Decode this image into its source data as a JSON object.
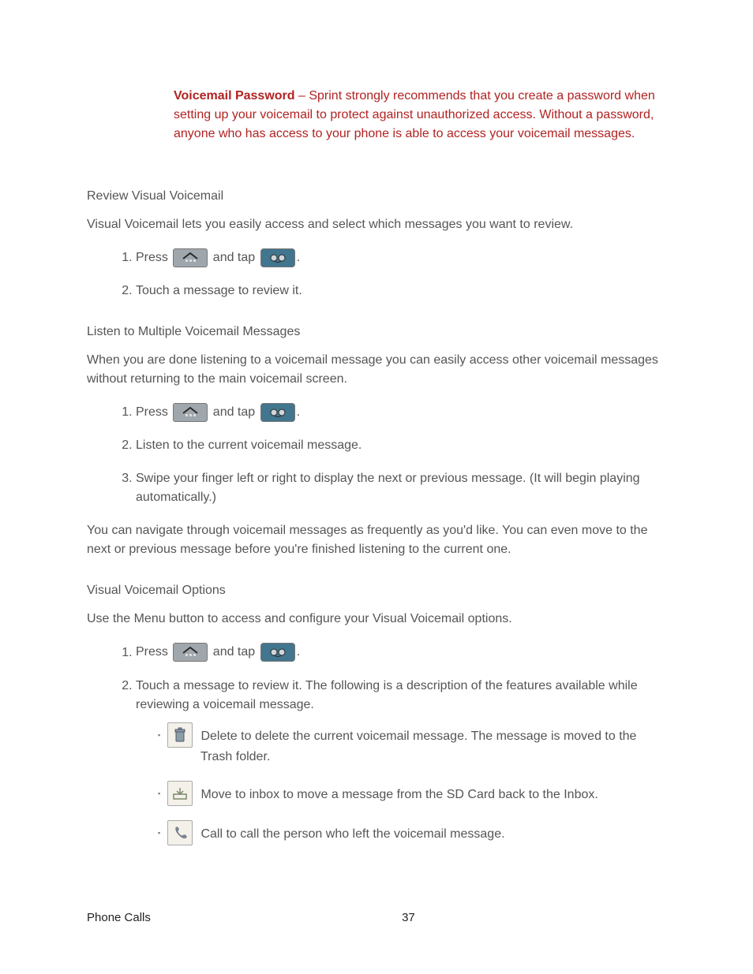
{
  "note": {
    "lead": "Voicemail Password",
    "body": " – Sprint strongly recommends that you create a password when setting up your voicemail to protect against unauthorized access. Without a password, anyone who has access to your phone is able to access your voicemail messages."
  },
  "sections": {
    "review": {
      "heading": "Review Visual Voicemail",
      "intro": "Visual Voicemail lets you easily access and select which messages you want to review.",
      "step1a": "Press ",
      "step1b": " and tap ",
      "step1c": ".",
      "step2": "Touch a message to review it."
    },
    "listen": {
      "heading": "Listen to Multiple Voicemail Messages",
      "intro": "When you are done listening to a voicemail message you can easily access other voicemail messages without returning to the main voicemail screen.",
      "step1a": "Press ",
      "step1b": " and tap ",
      "step1c": ".",
      "step2": "Listen to the current voicemail message.",
      "step3": "Swipe your finger left or right to display the next or previous message. (It will begin playing automatically.)",
      "outro": "You can navigate through voicemail messages as frequently as you'd like. You can even move to the next or previous message before you're finished listening to the current one."
    },
    "options": {
      "heading": "Visual Voicemail Options",
      "intro": "Use the Menu button to access and configure your Visual Voicemail options.",
      "step1a": "Press ",
      "step1b": " and tap ",
      "step1c": ".",
      "step2": "Touch a message to review it. The following is a description of the features available while reviewing a voicemail message.",
      "bullet1_label": "Delete",
      "bullet1_a": " to delete the current voicemail message. The message is moved to the ",
      "bullet1_b": "Trash",
      "bullet1_c": " folder.",
      "bullet2_label": "Move to inbox",
      "bullet2_a": " to move a message from the SD Card back to the Inbox.",
      "bullet3_label": "Call",
      "bullet3_a": " to call the person who left the voicemail message."
    }
  },
  "footer": {
    "left": "Phone Calls",
    "page": "37"
  }
}
